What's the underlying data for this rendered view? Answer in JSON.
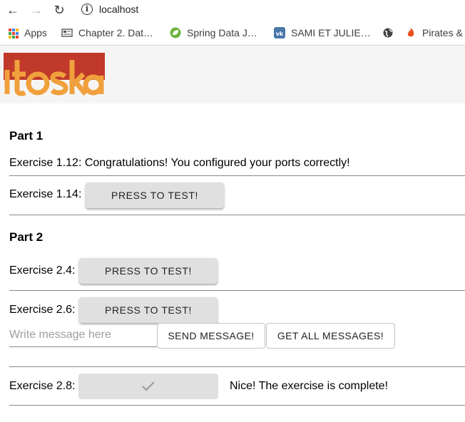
{
  "browser": {
    "url": "localhost",
    "bookmarks": [
      {
        "icon": "apps-grid-icon",
        "label": "Apps"
      },
      {
        "icon": "document-icon",
        "label": "Chapter 2. Dat…"
      },
      {
        "icon": "spring-leaf-icon",
        "label": "Spring Data J…"
      },
      {
        "icon": "vk-icon",
        "label": "SAMI ET JULIE…"
      },
      {
        "icon": "globe-icon",
        "label": ""
      },
      {
        "icon": "flame-icon",
        "label": "Pirates &"
      }
    ]
  },
  "colors": {
    "logo_red": "#c0392b",
    "logo_orange": "#f0a03c",
    "button_bg": "#e0e0e0",
    "header_bg": "#f5f5f5"
  },
  "part1": {
    "title": "Part 1",
    "ex112_text": "Exercise 1.12: Congratulations! You configured your ports correctly!",
    "ex114_label": "Exercise 1.14:",
    "ex114_button": "PRESS TO TEST!"
  },
  "part2": {
    "title": "Part 2",
    "ex24_label": "Exercise 2.4:",
    "ex24_button": "PRESS TO TEST!",
    "ex26_label": "Exercise 2.6:",
    "ex26_button": "PRESS TO TEST!",
    "message_placeholder": "Write message here",
    "send_button": "SEND MESSAGE!",
    "get_all_button": "GET ALL MESSAGES!",
    "ex28_label": "Exercise 2.8:",
    "ex28_result": "Nice! The exercise is complete!"
  }
}
